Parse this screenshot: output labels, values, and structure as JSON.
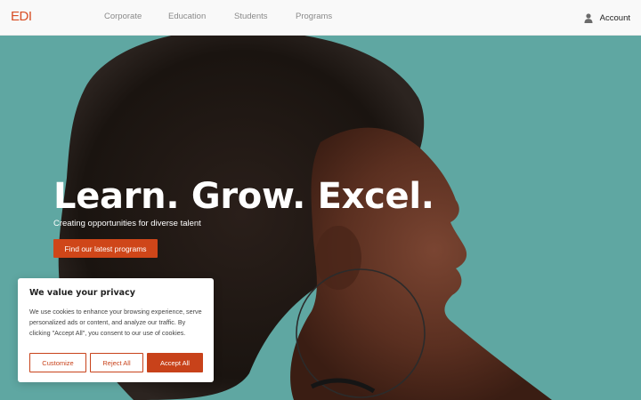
{
  "header": {
    "logo_text": "EDI",
    "nav": [
      {
        "label": "Corporate"
      },
      {
        "label": "Education"
      },
      {
        "label": "Students"
      },
      {
        "label": "Programs"
      }
    ],
    "account_label": "Account",
    "account_icon": "user-icon"
  },
  "hero": {
    "headline": "Learn. Grow. Excel.",
    "subheadline": "Creating opportunities for diverse talent",
    "cta_label": "Find our latest programs",
    "background_color": "#5fa7a2"
  },
  "cookie_banner": {
    "title": "We value your privacy",
    "body": "We use cookies to enhance your browsing experience, serve personalized ads or content, and analyze our traffic. By clicking \"Accept All\", you consent to our use of cookies.",
    "customize_label": "Customize",
    "reject_label": "Reject All",
    "accept_label": "Accept All"
  },
  "colors": {
    "brand": "#d84f25",
    "button": "#c8421a",
    "hero_teal": "#5fa7a2"
  }
}
